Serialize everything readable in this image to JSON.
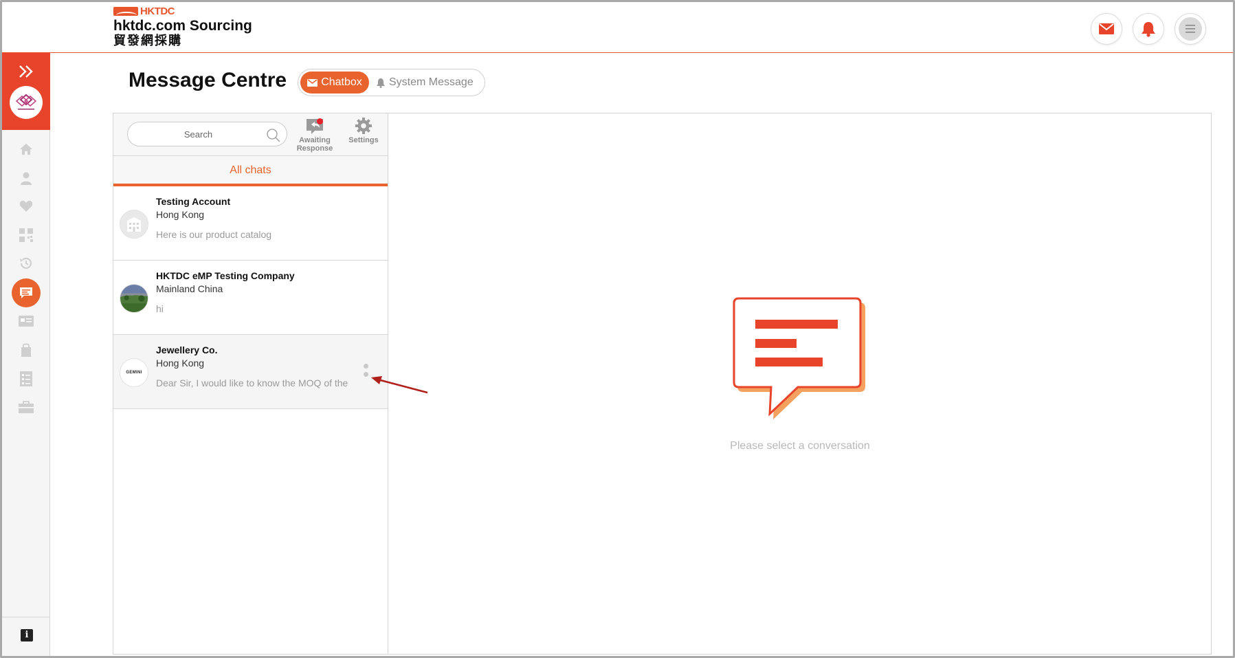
{
  "header": {
    "logo_brand": "HKTDC",
    "logo_title": "hktdc.com Sourcing",
    "logo_subtitle_cn": "貿發網採購",
    "icons": [
      "mail-icon",
      "bell-icon",
      "menu-icon"
    ]
  },
  "sidebar": {
    "items": [
      "home-icon",
      "user-icon",
      "heart-icon",
      "qr-icon",
      "history-icon",
      "chat-icon",
      "card-icon",
      "bag-icon",
      "checklist-icon",
      "briefcase-icon"
    ],
    "info_label": "i"
  },
  "page": {
    "title": "Message Centre",
    "tabs": [
      {
        "label": "Chatbox",
        "active": true
      },
      {
        "label": "System Message",
        "active": false
      }
    ]
  },
  "chat_list": {
    "search_placeholder": "Search",
    "awaiting_label_1": "Awaiting",
    "awaiting_label_2": "Response",
    "settings_label": "Settings",
    "filter_tab": "All chats",
    "items": [
      {
        "name": "Testing Account",
        "location": "Hong Kong",
        "preview": "Here is our product catalog"
      },
      {
        "name": "HKTDC eMP Testing Company",
        "location": "Mainland China",
        "preview": "hi"
      },
      {
        "name": "Jewellery Co.",
        "location": "Hong Kong",
        "preview": "Dear Sir, I would like to know the MOQ of the",
        "avatar_text": "GEMINI"
      }
    ]
  },
  "conversation": {
    "empty_text": "Please select a conversation"
  },
  "colors": {
    "accent": "#e8632e",
    "brand_red": "#e8432b",
    "muted_text": "#9a9a9a"
  }
}
